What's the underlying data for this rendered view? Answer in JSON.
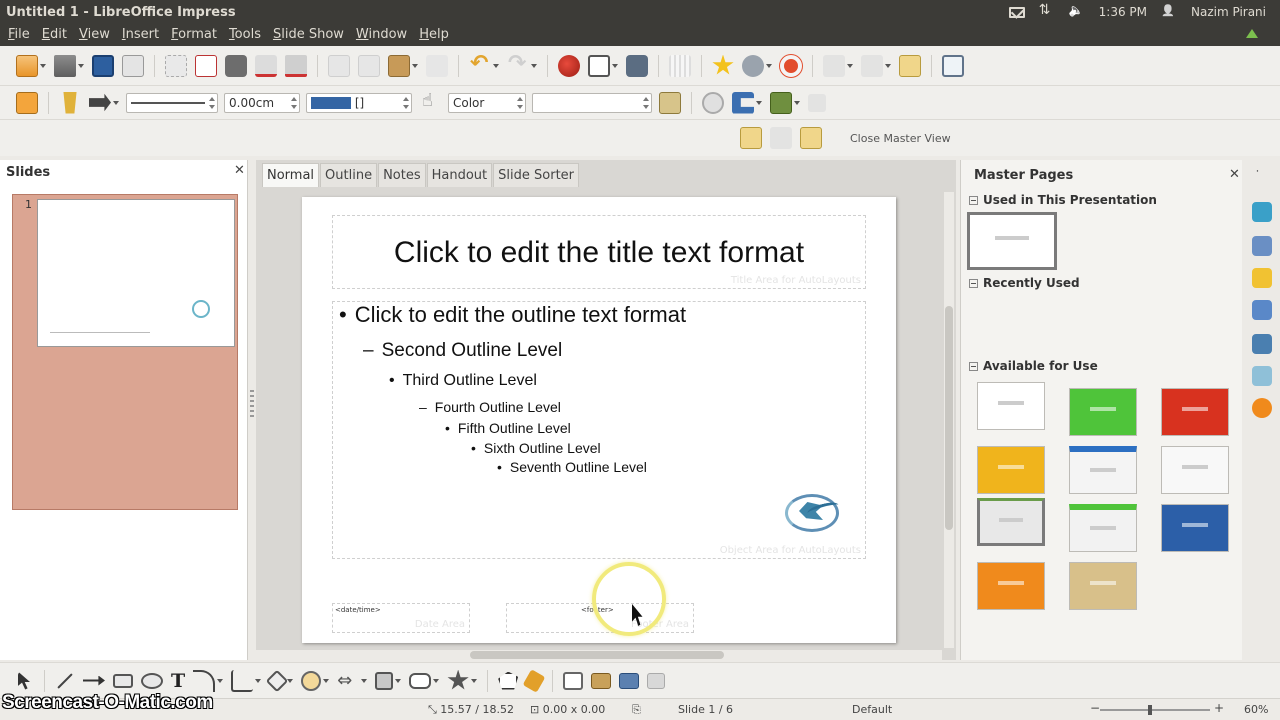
{
  "window": {
    "title": "Untitled 1 - LibreOffice Impress"
  },
  "tray": {
    "time": "1:36 PM",
    "user": "Nazim Pirani"
  },
  "menu": [
    "File",
    "Edit",
    "View",
    "Insert",
    "Format",
    "Tools",
    "Slide Show",
    "Window",
    "Help"
  ],
  "line_toolbar": {
    "line_width": "0.00cm",
    "area_style": "Color",
    "color_name": "[]"
  },
  "master_view_toolbar": {
    "close_label": "Close Master View"
  },
  "slides_pane": {
    "title": "Slides",
    "slide_number": "1"
  },
  "view_tabs": [
    "Normal",
    "Outline",
    "Notes",
    "Handout",
    "Slide Sorter"
  ],
  "slide": {
    "title_placeholder": "Click to edit the title text format",
    "title_area_label": "Title Area for AutoLayouts",
    "outline": [
      "Click to edit the outline text format",
      "Second Outline Level",
      "Third Outline Level",
      "Fourth Outline Level",
      "Fifth Outline Level",
      "Sixth Outline Level",
      "Seventh Outline Level"
    ],
    "bullets": [
      "•",
      "–",
      "•",
      "–",
      "•",
      "•",
      "•"
    ],
    "object_area_label": "Object Area for AutoLayouts",
    "date_field": "<date/time>",
    "date_area_label": "Date Area",
    "footer_field": "<footer>",
    "footer_area_label": "Footer Area"
  },
  "master_pages": {
    "title": "Master Pages",
    "used_section": "Used in This Presentation",
    "recent_section": "Recently Used",
    "available_section": "Available for Use",
    "available_colors": [
      "#ffffff",
      "#4fc43a",
      "#d8321f",
      "#f0b41c",
      "#f4f4f4",
      "#f8f8f8",
      "#e8e8e8",
      "#f2f2f2",
      "#2c5fa8",
      "#f08a1c",
      "#d8c08a"
    ]
  },
  "status": {
    "position": "15.57 / 18.52",
    "size": "0.00 x 0.00",
    "slide": "Slide 1 / 6",
    "layout": "Default",
    "zoom": "60%"
  },
  "watermark": "Screencast-O-Matic.com",
  "colors": {
    "titlebar": "#3c3b37",
    "slide_thumb_selected": "#dba592",
    "accent_blue": "#3465a4"
  }
}
